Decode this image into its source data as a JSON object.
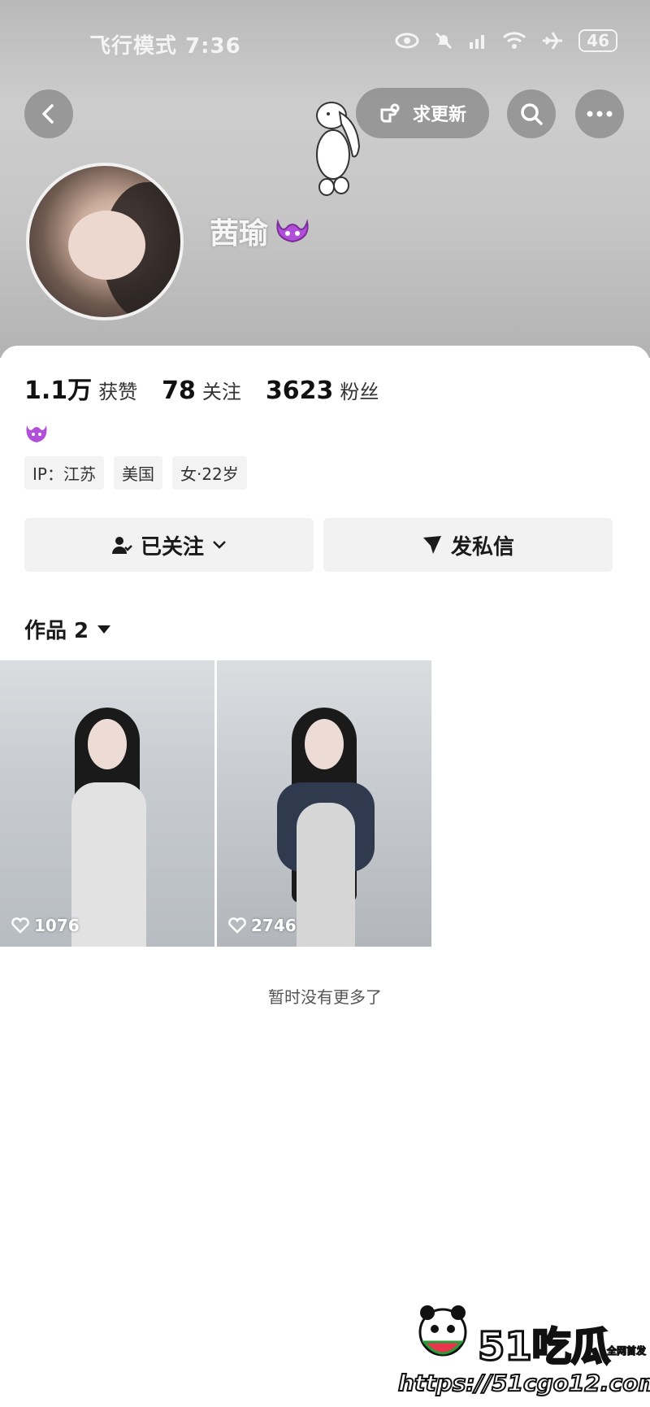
{
  "status_bar": {
    "left_text": "飞行模式 7:36",
    "battery": "46"
  },
  "header": {
    "update_request_label": "求更新",
    "username": "茜瑜"
  },
  "stats": {
    "likes_num": "1.1万",
    "likes_label": "获赞",
    "following_num": "78",
    "following_label": "关注",
    "followers_num": "3623",
    "followers_label": "粉丝"
  },
  "tags": [
    "IP：江苏",
    "美国",
    "女·22岁"
  ],
  "actions": {
    "follow_label": "已关注",
    "message_label": "发私信"
  },
  "works": {
    "title": "作品 2",
    "items": [
      {
        "likes": "1076"
      },
      {
        "likes": "2746"
      }
    ]
  },
  "footer_text": "暂时没有更多了",
  "watermark": {
    "brand": "51吃瓜",
    "sub": "全网首发",
    "url": "https://51cgo12.com"
  },
  "colors": {
    "header_gray": "#c6c6c6",
    "button_gray": "#f2f2f2",
    "crown_purple": "#b14fd8"
  }
}
